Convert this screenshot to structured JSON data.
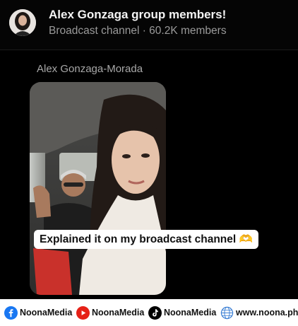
{
  "channel": {
    "name": "Alex Gonzaga group members!",
    "subtitle": "Broadcast channel · 60.2K members",
    "avatar_icon": "profile-avatar"
  },
  "message": {
    "sender": "Alex Gonzaga-Morada",
    "caption": "Explained it on my broadcast channel",
    "caption_emoji": "🫶"
  },
  "footer": {
    "items": [
      {
        "icon": "facebook-icon",
        "label": "NoonaMedia"
      },
      {
        "icon": "youtube-icon",
        "label": "NoonaMedia"
      },
      {
        "icon": "tiktok-icon",
        "label": "NoonaMedia"
      },
      {
        "icon": "globe-icon",
        "label": "www.noona.ph"
      }
    ]
  },
  "colors": {
    "background": "#000000",
    "facebook": "#1877F2",
    "youtube": "#E62117",
    "caption_bg": "#FFFFFF"
  }
}
